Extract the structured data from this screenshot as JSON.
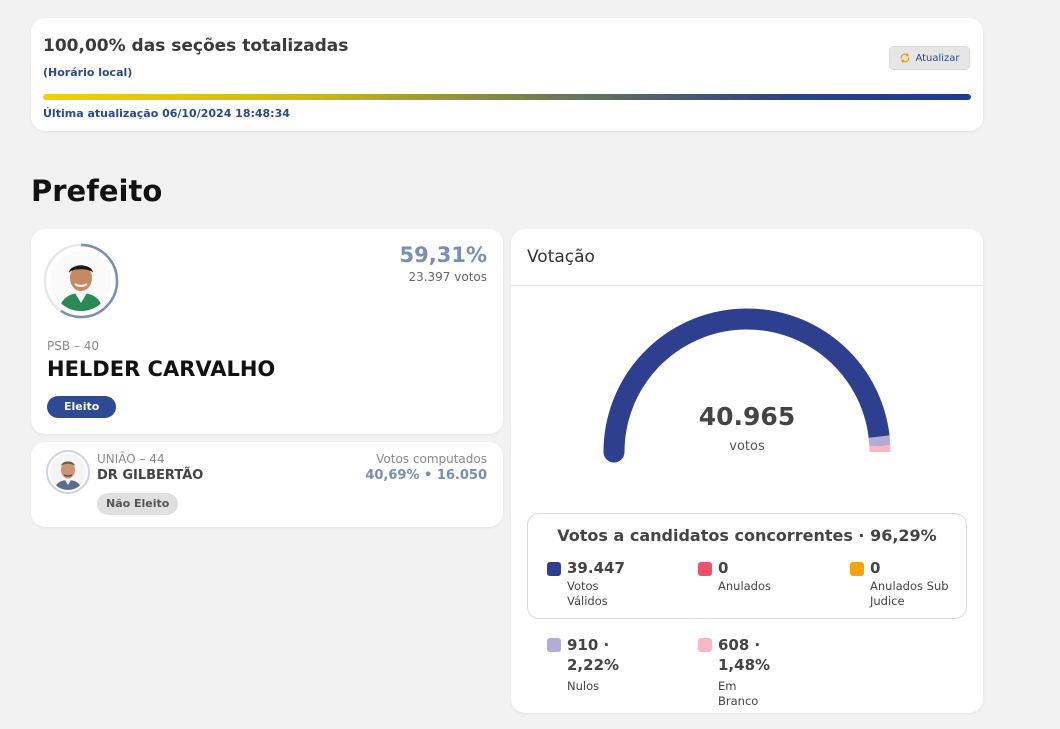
{
  "status": {
    "title": "100,00% das seções totalizadas",
    "subtitle": "(Horário local)",
    "refresh_label": "Atualizar",
    "progress_fraction": 1.0,
    "updated": "Última atualização 06/10/2024 18:48:34"
  },
  "section": {
    "title": "Prefeito"
  },
  "candidate_1": {
    "percent": "59,31%",
    "votes": "23.397 votos",
    "party": "PSB – 40",
    "name": "HELDER CARVALHO",
    "badge": "Eleito",
    "ring_fraction": 0.5931
  },
  "candidate_2": {
    "party": "UNIÃO – 44",
    "name": "DR GILBERTÃO",
    "votes_label": "Votos computados",
    "stats": "40,69%  •  16.050",
    "badge": "Não Eleito"
  },
  "votacao": {
    "title": "Votação",
    "total": "40.965",
    "total_unit": "votos",
    "gauge_fractions": {
      "validos": 0.9629,
      "nulos": 0.0222,
      "branco": 0.0148
    },
    "concorrentes_title": "Votos a candidatos concorrentes · 96,29%",
    "legend": [
      {
        "value": "39.447",
        "label": "Votos Válidos",
        "color": "#2e3f8f"
      },
      {
        "value": "0",
        "label": "Anulados",
        "color": "#f0506e"
      },
      {
        "value": "0",
        "label": "Anulados Sub Judice",
        "color": "#f5a30f"
      },
      {
        "value": "910 · 2,22%",
        "label": "Nulos",
        "color": "#b3acd6"
      },
      {
        "value": "608 · 1,48%",
        "label": "Em Branco",
        "color": "#f7b8c4"
      }
    ]
  },
  "colors": {
    "accent": "#2e4a95",
    "gauge_main": "#2e3f8f",
    "gauge_nulos": "#b3acd6",
    "gauge_branco": "#f7b8c4"
  }
}
